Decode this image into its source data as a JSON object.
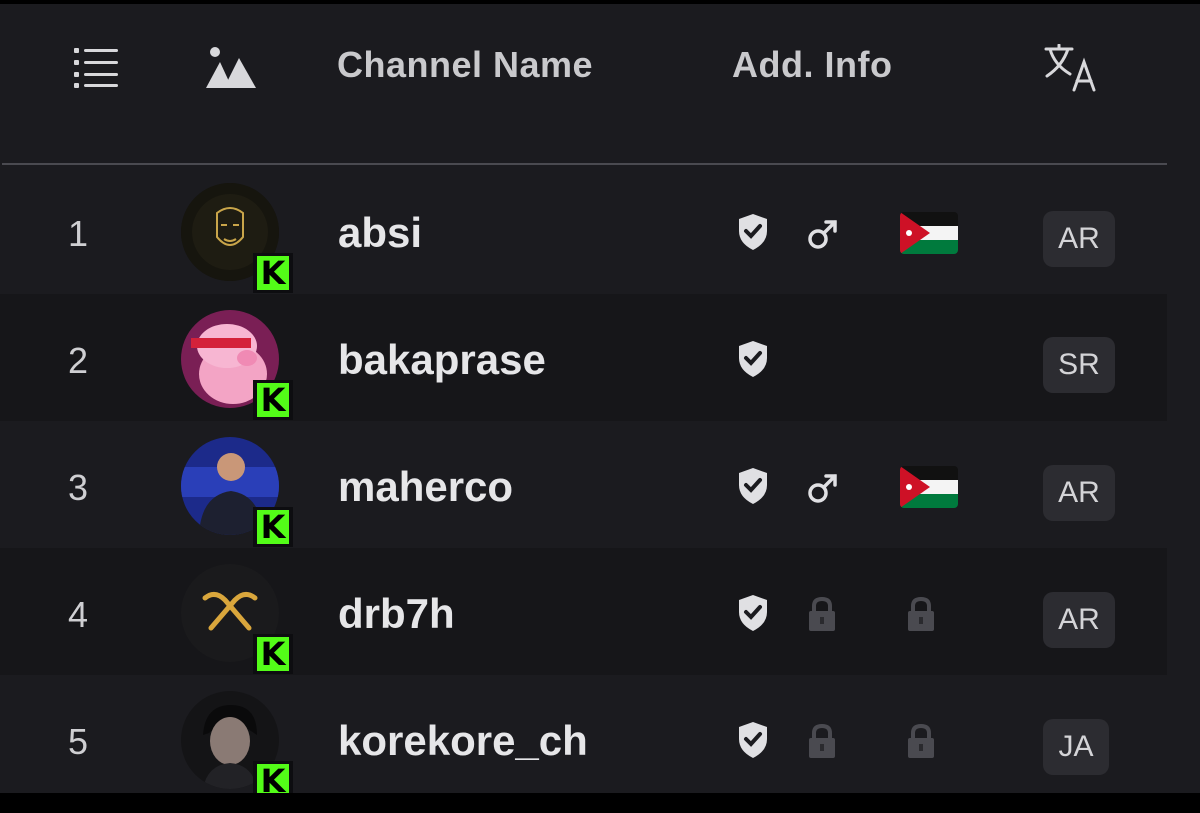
{
  "header": {
    "channel_name_label": "Channel Name",
    "add_info_label": "Add. Info",
    "list_icon": "list-icon",
    "avatar_column_icon": "mountains-icon",
    "language_icon": "translate-icon"
  },
  "rows": [
    {
      "rank": "1",
      "name": "absi",
      "verified": true,
      "gender": "male",
      "flag": "jordan",
      "lang": "AR"
    },
    {
      "rank": "2",
      "name": "bakaprase",
      "verified": true,
      "gender": "",
      "flag": "",
      "lang": "SR"
    },
    {
      "rank": "3",
      "name": "maherco",
      "verified": true,
      "gender": "male",
      "flag": "jordan",
      "lang": "AR"
    },
    {
      "rank": "4",
      "name": "drb7h",
      "verified": true,
      "gender": "locked",
      "flag": "locked",
      "lang": "AR"
    },
    {
      "rank": "5",
      "name": "korekore_ch",
      "verified": true,
      "gender": "locked",
      "flag": "locked",
      "lang": "JA"
    }
  ],
  "platform_badge": "K",
  "colors": {
    "background": "#1b1b1f",
    "kick_green": "#53fc18",
    "text": "#e6e6e8",
    "muted": "#c9c9cc"
  }
}
